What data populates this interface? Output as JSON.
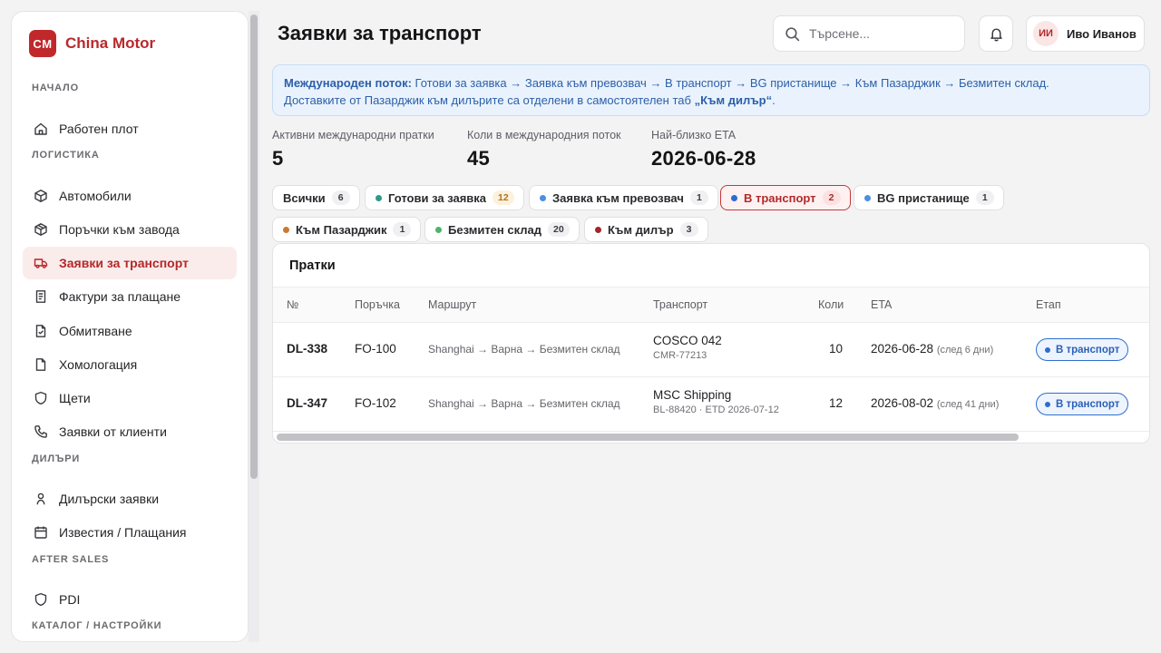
{
  "brand": {
    "logo": "CM",
    "name": "China Motor"
  },
  "sidebar": {
    "sections": [
      {
        "label": "НАЧАЛО"
      },
      {
        "label": "ЛОГИСТИКА"
      },
      {
        "label": "ДИЛЪРИ"
      },
      {
        "label": "AFTER SALES"
      },
      {
        "label": "КАТАЛОГ / НАСТРОЙКИ"
      }
    ],
    "items": [
      {
        "label": "Работен плот",
        "icon": "home-icon"
      },
      {
        "label": "Автомобили",
        "icon": "box-icon"
      },
      {
        "label": "Поръчки към завода",
        "icon": "package-icon"
      },
      {
        "label": "Заявки за транспорт",
        "icon": "truck-icon",
        "active": true
      },
      {
        "label": "Фактури за плащане",
        "icon": "receipt-icon"
      },
      {
        "label": "Обмитяване",
        "icon": "file-check-icon"
      },
      {
        "label": "Хомологация",
        "icon": "file-icon"
      },
      {
        "label": "Щети",
        "icon": "shield-icon"
      },
      {
        "label": "Заявки от клиенти",
        "icon": "phone-icon"
      },
      {
        "label": "Дилърски заявки",
        "icon": "user-icon"
      },
      {
        "label": "Известия / Плащания",
        "icon": "calendar-icon"
      },
      {
        "label": "PDI",
        "icon": "shield-icon"
      }
    ]
  },
  "header": {
    "title": "Заявки за транспорт",
    "search_placeholder": "Търсене...",
    "user": {
      "initials": "ИИ",
      "name": "Иво Иванов"
    }
  },
  "banner": {
    "lead": "Международен поток:",
    "flow": " Готови за заявка → Заявка към превозвач → В транспорт → BG пристанище → Към Пазарджик → Безмитен склад.",
    "line2_pre": "Доставките от Пазарджик към дилърите са отделени в самостоятелен таб ",
    "line2_bold": "„Към дилър“",
    "line2_post": "."
  },
  "stats": [
    {
      "label": "Активни международни пратки",
      "value": "5"
    },
    {
      "label": "Коли в международния поток",
      "value": "45"
    },
    {
      "label": "Най-близко ETA",
      "value": "2026-06-28"
    }
  ],
  "filters": [
    {
      "label": "Всички",
      "count": "6",
      "color": ""
    },
    {
      "label": "Готови за заявка",
      "count": "12",
      "color": "#2e9a8a"
    },
    {
      "label": "Заявка към превозвач",
      "count": "1",
      "color": "#4a8ee6"
    },
    {
      "label": "В транспорт",
      "count": "2",
      "color": "#2d6bd2",
      "active": true
    },
    {
      "label": "BG пристанище",
      "count": "1",
      "color": "#4a8ee6"
    },
    {
      "label": "Към Пазарджик",
      "count": "1",
      "color": "#c97a2c"
    },
    {
      "label": "Безмитен склад",
      "count": "20",
      "color": "#4fb36a"
    },
    {
      "label": "Към дилър",
      "count": "3",
      "color": "#a3262a"
    }
  ],
  "table": {
    "title": "Пратки",
    "columns": [
      "№",
      "Поръчка",
      "Маршрут",
      "Транспорт",
      "Коли",
      "ETA",
      "Етап"
    ],
    "rows": [
      {
        "no": "DL-338",
        "order": "FO-100",
        "route": "Shanghai → Варна → Безмитен склад",
        "transport": "COSCO 042",
        "transport_sub": "CMR-77213",
        "cars": "10",
        "eta": "2026-06-28",
        "eta_note": "(след 6 дни)",
        "stage": "В транспорт"
      },
      {
        "no": "DL-347",
        "order": "FO-102",
        "route": "Shanghai → Варна → Безмитен склад",
        "transport": "MSC Shipping",
        "transport_sub": "BL-88420 · ETD 2026-07-12",
        "cars": "12",
        "eta": "2026-08-02",
        "eta_note": "(след 41 дни)",
        "stage": "В транспорт"
      }
    ]
  }
}
